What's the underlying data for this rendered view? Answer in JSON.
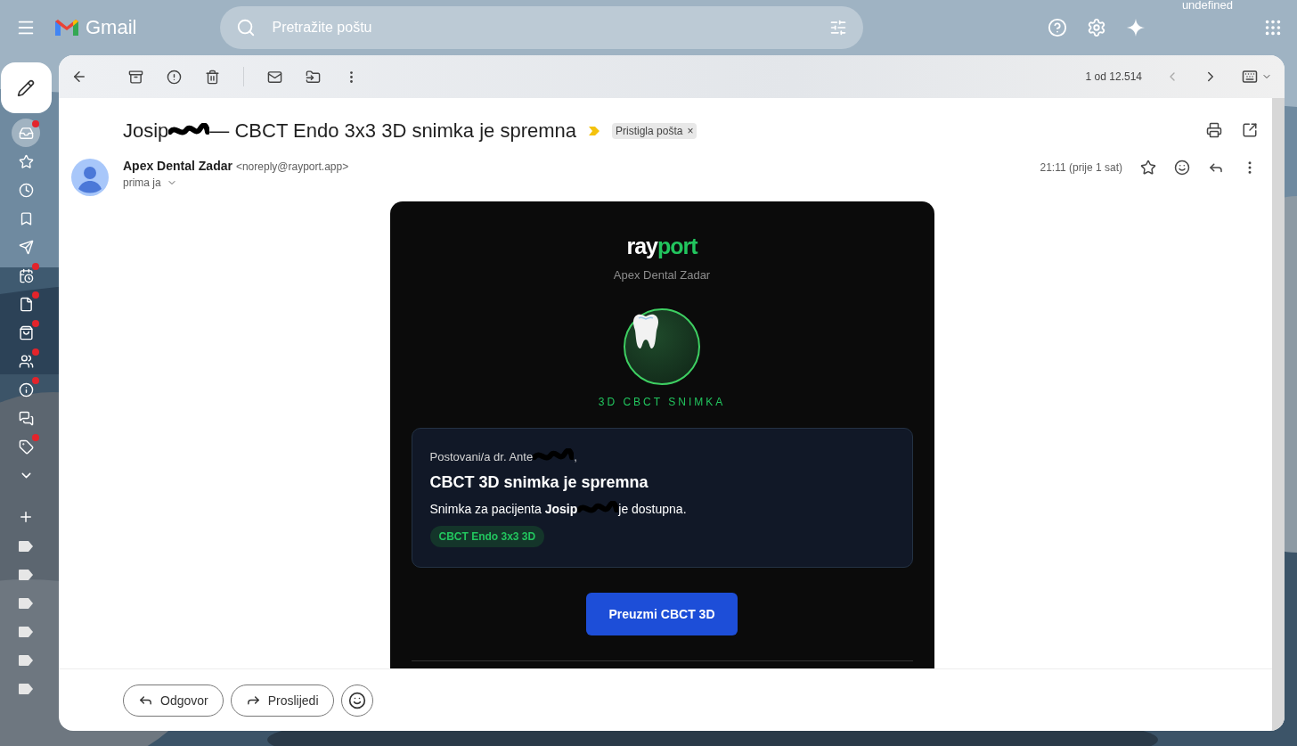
{
  "app": {
    "name": "Gmail",
    "account_label": "undefined"
  },
  "search": {
    "placeholder": "Pretražite poštu"
  },
  "sidebar": {
    "items": [
      {
        "kind": "inbox",
        "selected": true,
        "badge": true
      },
      {
        "kind": "star",
        "selected": false,
        "badge": false
      },
      {
        "kind": "clock",
        "selected": false,
        "badge": false
      },
      {
        "kind": "important",
        "selected": false,
        "badge": false
      },
      {
        "kind": "send",
        "selected": false,
        "badge": false
      },
      {
        "kind": "scheduled",
        "selected": false,
        "badge": true
      },
      {
        "kind": "draft",
        "selected": false,
        "badge": true
      },
      {
        "kind": "shopping",
        "selected": false,
        "badge": true
      },
      {
        "kind": "people",
        "selected": false,
        "badge": true
      },
      {
        "kind": "info",
        "selected": false,
        "badge": true
      },
      {
        "kind": "forums",
        "selected": false,
        "badge": false
      },
      {
        "kind": "tag",
        "selected": false,
        "badge": true
      },
      {
        "kind": "more",
        "selected": false,
        "badge": false
      }
    ],
    "labels": [
      {
        "kind": "label"
      },
      {
        "kind": "label"
      },
      {
        "kind": "label"
      },
      {
        "kind": "label"
      },
      {
        "kind": "label"
      },
      {
        "kind": "label"
      }
    ]
  },
  "toolbar": {
    "pager": "1 od 12.514"
  },
  "message": {
    "subject_start": "Josip",
    "subject_end": "— CBCT Endo 3x3 3D snimka je spremna",
    "label_chip": "Pristigla pošta",
    "chip_close": "×",
    "sender_name": "Apex Dental Zadar",
    "sender_email": "<noreply@rayport.app>",
    "recipient": "prima ja",
    "time": "21:11 (prije 1 sat)"
  },
  "email": {
    "brand_lead": "ray",
    "brand_accent": "port",
    "clinic": "Apex Dental Zadar",
    "caption": "3D CBCT SNIMKA",
    "greeting": "Postovani/a dr. Ante",
    "greeting_end": ",",
    "heading": "CBCT 3D snimka je spremna",
    "body_start": "Snimka za pacijenta **Josip**",
    "body_end": "je dostupna.",
    "tag": "CBCT Endo 3x3 3D",
    "button": "Preuzmi CBCT 3D"
  },
  "actions": {
    "reply": "Odgovor",
    "forward": "Proslijedi"
  }
}
